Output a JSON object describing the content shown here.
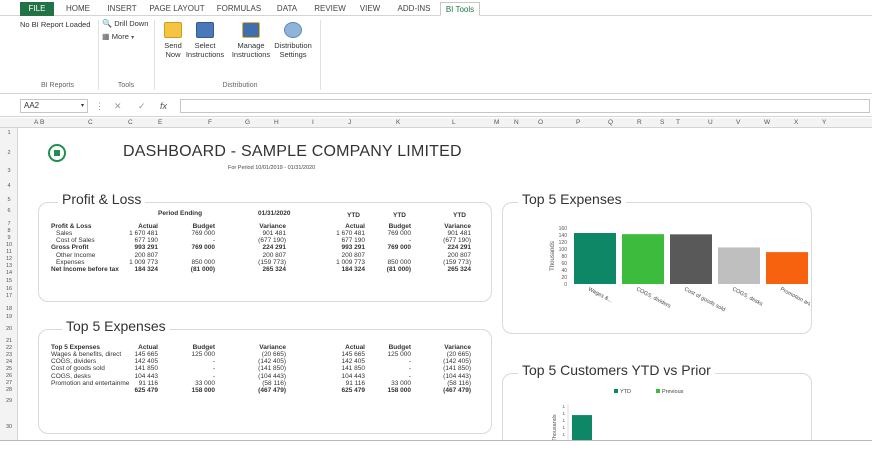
{
  "ribbon_tabs": [
    {
      "label": "FILE"
    },
    {
      "label": "HOME"
    },
    {
      "label": "INSERT"
    },
    {
      "label": "PAGE LAYOUT"
    },
    {
      "label": "FORMULAS"
    },
    {
      "label": "DATA"
    },
    {
      "label": "REVIEW"
    },
    {
      "label": "VIEW"
    },
    {
      "label": "ADD-INS"
    },
    {
      "label": "BI Tools"
    }
  ],
  "ribbon": {
    "report_status": "No BI Report Loaded",
    "drill_down": "Drill Down",
    "more": "More",
    "group_bi_reports": "BI Reports",
    "group_tools": "Tools",
    "group_distribution": "Distribution",
    "send_now": [
      "Send",
      "Now"
    ],
    "select_instructions": [
      "Select",
      "Instructions"
    ],
    "manage_instructions": [
      "Manage",
      "Instructions"
    ],
    "distribution_settings": [
      "Distribution",
      "Settings"
    ]
  },
  "formula_bar": {
    "name_box": "AA2",
    "fx": "fx",
    "cancel": "✕",
    "enter": "✓"
  },
  "columns": [
    "A",
    "B",
    "C",
    "C",
    "E",
    "F",
    "G",
    "H",
    "I",
    "J",
    "K",
    "L",
    "M",
    "N",
    "O",
    "P",
    "Q",
    "R",
    "S",
    "T",
    "U",
    "V",
    "W",
    "X",
    "Y"
  ],
  "rows": [
    "1",
    "2",
    "3",
    "4",
    "5",
    "6",
    "7",
    "8",
    "9",
    "10",
    "11",
    "12",
    "13",
    "14",
    "15",
    "16",
    "17",
    "18",
    "19",
    "20",
    "21",
    "22",
    "23",
    "24",
    "25",
    "26",
    "27",
    "28",
    "29",
    "30"
  ],
  "dashboard": {
    "title": "DASHBOARD - SAMPLE COMPANY LIMITED",
    "period": "For Period 10/01/2019 - 01/31/2020"
  },
  "pl": {
    "title": "Profit & Loss",
    "period_ending": "Period Ending",
    "date": "01/31/2020",
    "ytd": [
      "YTD",
      "YTD",
      "YTD"
    ],
    "headers": [
      "Profit & Loss",
      "Actual",
      "Budget",
      "Variance",
      "Actual",
      "Budget",
      "Variance"
    ],
    "rows": [
      {
        "label": "Sales",
        "values": [
          "1 670 481",
          "769 000",
          "901 481",
          "1 670 481",
          "769 000",
          "901 481"
        ],
        "bold": false,
        "indent": true
      },
      {
        "label": "Cost of Sales",
        "values": [
          "677 190",
          "-",
          "(677 190)",
          "677 190",
          "-",
          "(677 190)"
        ],
        "bold": false,
        "indent": true
      },
      {
        "label": "Gross Profit",
        "values": [
          "993 291",
          "769 000",
          "224 291",
          "993 291",
          "769 000",
          "224 291"
        ],
        "bold": true,
        "indent": false
      },
      {
        "label": "Other Income",
        "values": [
          "200 807",
          "",
          "200 807",
          "200 807",
          "",
          "200 807"
        ],
        "bold": false,
        "indent": true
      },
      {
        "label": "Expenses",
        "values": [
          "1 009 773",
          "850 000",
          "(159 773)",
          "1 009 773",
          "850 000",
          "(159 773)"
        ],
        "bold": false,
        "indent": true
      },
      {
        "label": "Net Income before tax",
        "values": [
          "184 324",
          "(81 000)",
          "265 324",
          "184 324",
          "(81 000)",
          "265 324"
        ],
        "bold": true,
        "indent": false
      }
    ]
  },
  "expenses": {
    "title": "Top 5 Expenses",
    "headers": [
      "Top 5 Expenses",
      "Actual",
      "Budget",
      "Variance",
      "Actual",
      "Budget",
      "Variance"
    ],
    "rows": [
      {
        "label": "Wages & benefits, direct",
        "values": [
          "145 665",
          "125 000",
          "(20 665)",
          "145 665",
          "125 000",
          "(20 665)"
        ]
      },
      {
        "label": "COGS, dividers",
        "values": [
          "142 405",
          "-",
          "(142 405)",
          "142 405",
          "-",
          "(142 405)"
        ]
      },
      {
        "label": "Cost of goods sold",
        "values": [
          "141 850",
          "-",
          "(141 850)",
          "141 850",
          "-",
          "(141 850)"
        ]
      },
      {
        "label": "COGS, desks",
        "values": [
          "104 443",
          "-",
          "(104 443)",
          "104 443",
          "-",
          "(104 443)"
        ]
      },
      {
        "label": "Promotion and entertainme",
        "values": [
          "91 116",
          "33 000",
          "(58 116)",
          "91 116",
          "33 000",
          "(58 116)"
        ]
      }
    ],
    "total": [
      "625 479",
      "158 000",
      "(467 479)",
      "625 479",
      "158 000",
      "(467 479)"
    ]
  },
  "chart_data": [
    {
      "type": "bar",
      "title": "Top 5 Expenses",
      "ylabel": "Thousands",
      "categories": [
        "Wages &...",
        "COGS, dividers",
        "Cost of goods sold",
        "COGS, desks",
        "Promotion and..."
      ],
      "values": [
        145.665,
        142.405,
        141.85,
        104.443,
        91.116
      ],
      "colors": [
        "#0e8766",
        "#3dbb3d",
        "#595959",
        "#bfbfbf",
        "#f7620f"
      ],
      "ylim": [
        0,
        160
      ],
      "yticks": [
        "0",
        "20",
        "40",
        "60",
        "80",
        "100",
        "120",
        "140",
        "160"
      ]
    },
    {
      "type": "bar",
      "title": "Top 5 Customers YTD vs Prior",
      "ylabel": "Thousands",
      "legend": [
        "YTD",
        "Previous"
      ],
      "legend_colors": [
        "#0e8766",
        "#3dbb3d"
      ],
      "yticks": [
        "1",
        "1",
        "1",
        "1",
        "1"
      ],
      "series": [
        {
          "name": "YTD",
          "values": [
            0.9
          ]
        }
      ],
      "ylim": [
        0,
        1.3
      ]
    }
  ]
}
